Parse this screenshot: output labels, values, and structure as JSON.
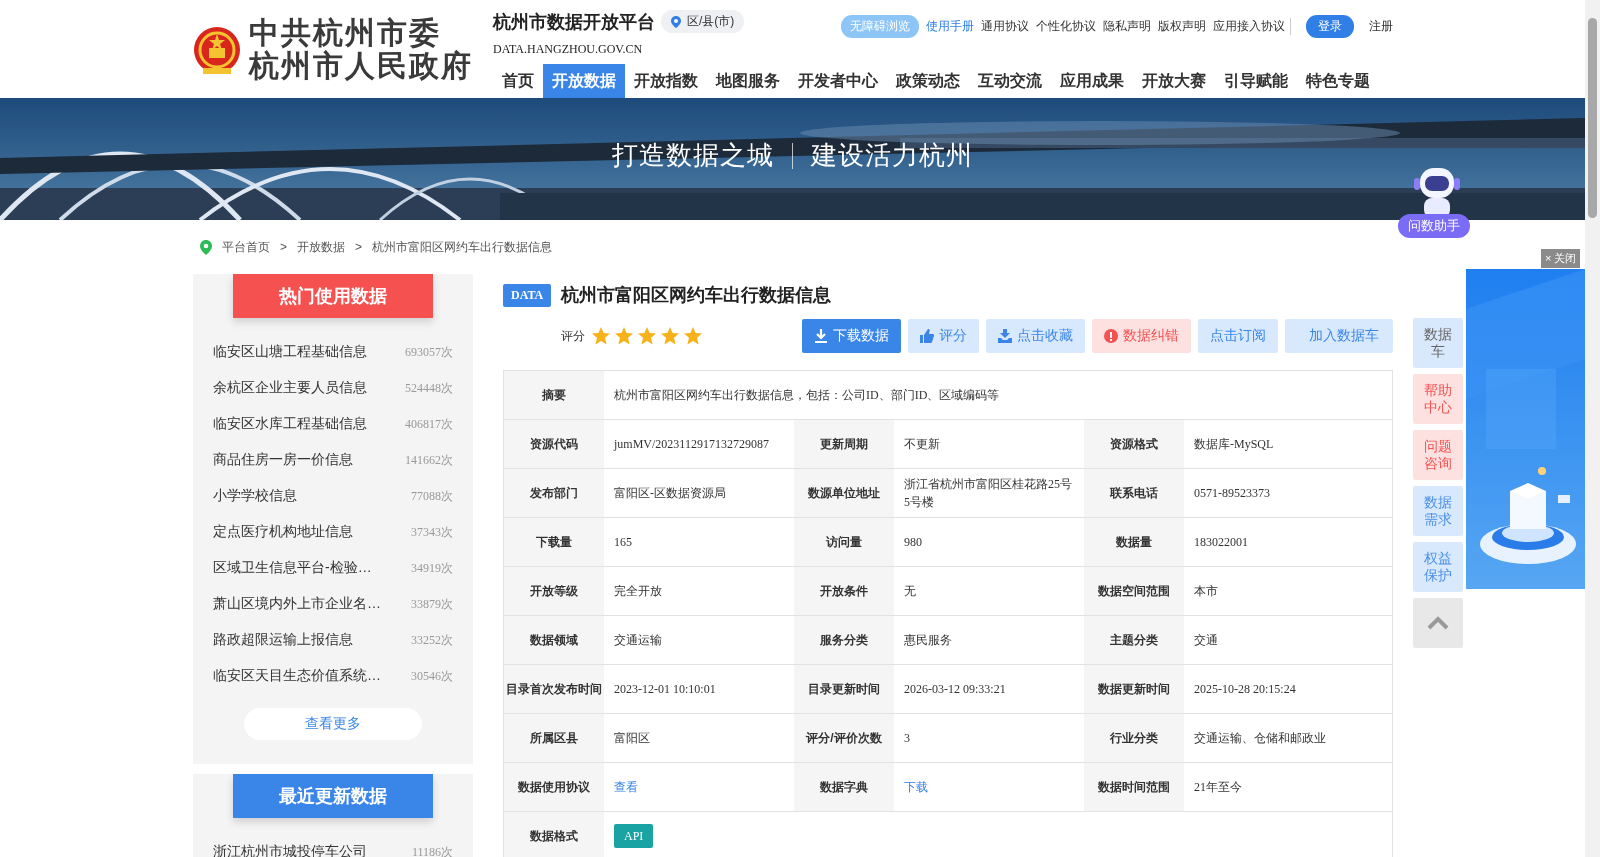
{
  "header": {
    "org_lines": [
      "中共杭州市委",
      "杭州市人民政府"
    ],
    "platform_title": "杭州市数据开放平台",
    "region_select": "区/县(市)",
    "domain": "DATA.HANGZHOU.GOV.CN",
    "top_links": [
      {
        "label": "无障碍浏览",
        "kind": "pill"
      },
      {
        "label": "使用手册",
        "kind": "highlight"
      },
      {
        "label": "通用协议",
        "kind": "plain"
      },
      {
        "label": "个性化协议",
        "kind": "plain"
      },
      {
        "label": "隐私声明",
        "kind": "plain"
      },
      {
        "label": "版权声明",
        "kind": "plain"
      },
      {
        "label": "应用接入协议",
        "kind": "plain"
      },
      {
        "label": "登录",
        "kind": "button"
      },
      {
        "label": "注册",
        "kind": "plain"
      }
    ],
    "nav": [
      {
        "label": "首页",
        "selected": false
      },
      {
        "label": "开放数据",
        "selected": true
      },
      {
        "label": "开放指数",
        "selected": false
      },
      {
        "label": "地图服务",
        "selected": false
      },
      {
        "label": "开发者中心",
        "selected": false
      },
      {
        "label": "政策动态",
        "selected": false
      },
      {
        "label": "互动交流",
        "selected": false
      },
      {
        "label": "应用成果",
        "selected": false
      },
      {
        "label": "开放大赛",
        "selected": false
      },
      {
        "label": "引导赋能",
        "selected": false
      },
      {
        "label": "特色专题",
        "selected": false
      }
    ]
  },
  "banner": {
    "kind": "picture",
    "slogan": [
      "打造数据之城",
      "建设活力杭州"
    ]
  },
  "assistant": {
    "label": "问数助手"
  },
  "breadcrumb": {
    "separator": ">",
    "items": [
      "平台首页",
      "开放数据",
      "杭州市富阳区网约车出行数据信息"
    ]
  },
  "hot_data": {
    "title": "热门使用数据",
    "more": "查看更多",
    "items": [
      {
        "name": "临安区山塘工程基础信息",
        "count": "693057次"
      },
      {
        "name": "余杭区企业主要人员信息",
        "count": "524448次"
      },
      {
        "name": "临安区水库工程基础信息",
        "count": "406817次"
      },
      {
        "name": "商品住房一房一价信息",
        "count": "141662次"
      },
      {
        "name": "小学学校信息",
        "count": "77088次"
      },
      {
        "name": "定点医疗机构地址信息",
        "count": "37343次"
      },
      {
        "name": "区域卫生信息平台-检验…",
        "count": "34919次"
      },
      {
        "name": "萧山区境内外上市企业名…",
        "count": "33879次"
      },
      {
        "name": "路政超限运输上报信息",
        "count": "33252次"
      },
      {
        "name": "临安区天目生态价值系统…",
        "count": "30546次"
      }
    ]
  },
  "recent_data": {
    "title": "最近更新数据",
    "items": [
      {
        "name": "浙江杭州市城投停车公司",
        "count": "11186次"
      }
    ]
  },
  "dataset": {
    "badge": "DATA",
    "title": "杭州市富阳区网约车出行数据信息",
    "rating_label": "评分",
    "stars": 5,
    "actions": [
      {
        "label": "下载数据",
        "kind": "download"
      },
      {
        "label": "评分",
        "kind": "rate"
      },
      {
        "label": "点击收藏",
        "kind": "collect"
      },
      {
        "label": "数据纠错",
        "kind": "report"
      },
      {
        "label": "点击订阅",
        "kind": "subscribe"
      },
      {
        "label": "加入数据车",
        "kind": "cart"
      }
    ],
    "summary": {
      "label": "摘要",
      "value": "杭州市富阳区网约车出行数据信息，包括：公司ID、部门ID、区域编码等"
    },
    "fields": [
      {
        "label": "资源代码",
        "value": "jumMV/2023112917132729087",
        "kind": "text"
      },
      {
        "label": "更新周期",
        "value": "不更新",
        "kind": "text"
      },
      {
        "label": "资源格式",
        "value": "数据库-MySQL",
        "kind": "text"
      },
      {
        "label": "发布部门",
        "value": "富阳区-区数据资源局",
        "kind": "text"
      },
      {
        "label": "数源单位地址",
        "value": "浙江省杭州市富阳区桂花路25号5号楼",
        "kind": "text"
      },
      {
        "label": "联系电话",
        "value": "0571-89523373",
        "kind": "text"
      },
      {
        "label": "下载量",
        "value": "165",
        "kind": "text"
      },
      {
        "label": "访问量",
        "value": "980",
        "kind": "text"
      },
      {
        "label": "数据量",
        "value": "183022001",
        "kind": "text"
      },
      {
        "label": "开放等级",
        "value": "完全开放",
        "kind": "text"
      },
      {
        "label": "开放条件",
        "value": "无",
        "kind": "text"
      },
      {
        "label": "数据空间范围",
        "value": "本市",
        "kind": "text"
      },
      {
        "label": "数据领域",
        "value": "交通运输",
        "kind": "text"
      },
      {
        "label": "服务分类",
        "value": "惠民服务",
        "kind": "text"
      },
      {
        "label": "主题分类",
        "value": "交通",
        "kind": "text"
      },
      {
        "label": "目录首次发布时间",
        "value": "2023-12-01 10:10:01",
        "kind": "text"
      },
      {
        "label": "目录更新时间",
        "value": "2026-03-12 09:33:21",
        "kind": "text"
      },
      {
        "label": "数据更新时间",
        "value": "2025-10-28 20:15:24",
        "kind": "text"
      },
      {
        "label": "所属区县",
        "value": "富阳区",
        "kind": "text"
      },
      {
        "label": "评分/评价次数",
        "value": "3",
        "kind": "text"
      },
      {
        "label": "行业分类",
        "value": "交通运输、仓储和邮政业",
        "kind": "text"
      },
      {
        "label": "数据使用协议",
        "value": "查看",
        "kind": "link"
      },
      {
        "label": "数据字典",
        "value": "下载",
        "kind": "link"
      },
      {
        "label": "数据时间范围",
        "value": "21年至今",
        "kind": "text"
      }
    ],
    "format": {
      "label": "数据格式",
      "tags": [
        "API"
      ]
    }
  },
  "side_tools": [
    {
      "label": "数据车",
      "kind": "neutral"
    },
    {
      "label": "帮助中心",
      "kind": "alert"
    },
    {
      "label": "问题咨询",
      "kind": "alert"
    },
    {
      "label": "数据需求",
      "kind": "info"
    },
    {
      "label": "权益保护",
      "kind": "info"
    }
  ],
  "ad": {
    "kind": "picture",
    "close": "× 关闭"
  }
}
